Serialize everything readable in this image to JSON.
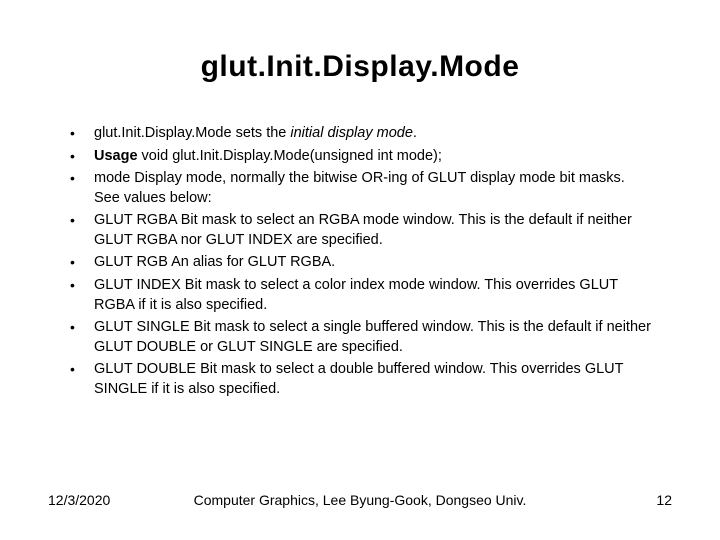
{
  "title": "glut.Init.Display.Mode",
  "bullets": [
    {
      "pre": "glut.Init.Display.Mode sets the ",
      "em": "initial display mode",
      "post": "."
    },
    {
      "strong": "Usage",
      "rest": " void glut.Init.Display.Mode(unsigned int mode);"
    },
    {
      "text": "mode Display mode, normally the bitwise OR-ing of GLUT display mode bit masks. See values below:"
    },
    {
      "text": "GLUT RGBA Bit mask to select an RGBA mode window. This is the default if neither GLUT RGBA nor GLUT INDEX are specified."
    },
    {
      "text": "GLUT RGB An alias for GLUT RGBA."
    },
    {
      "text": "GLUT INDEX Bit mask to select a color index mode window. This overrides GLUT RGBA if it is also specified."
    },
    {
      "text": "GLUT SINGLE Bit mask to select a single buffered window. This is the default if neither GLUT DOUBLE or GLUT SINGLE are specified."
    },
    {
      "text": "GLUT DOUBLE Bit mask to select a double buffered window. This overrides GLUT SINGLE if it is also specified."
    }
  ],
  "footer": {
    "date": "12/3/2020",
    "center": "Computer Graphics, Lee Byung-Gook, Dongseo Univ.",
    "page": "12"
  }
}
